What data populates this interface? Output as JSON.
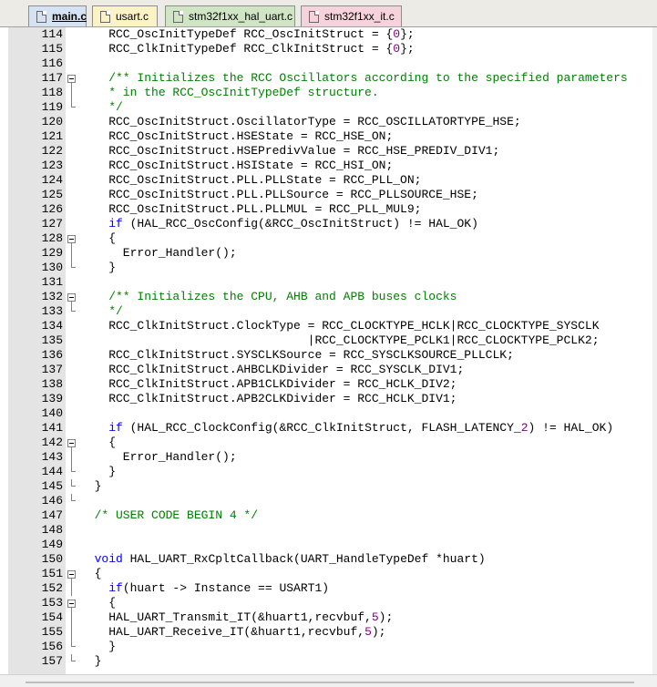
{
  "tabs": [
    {
      "label": "main.c",
      "bg": "#d5e2f3",
      "active": true
    },
    {
      "label": "usart.c",
      "bg": "#fbf3c3",
      "active": false
    },
    {
      "label": "stm32f1xx_hal_uart.c",
      "bg": "#cfe5c4",
      "active": false
    },
    {
      "label": "stm32f1xx_it.c",
      "bg": "#f6d3dc",
      "active": false
    }
  ],
  "colors": {
    "keyword": "#0000ff",
    "comment": "#008000",
    "number": "#800080",
    "gutter": "#e4e4e4"
  },
  "lines": [
    {
      "n": "114",
      "code": [
        [
          "    RCC_OscInitTypeDef RCC_OscInitStruct = {",
          ""
        ],
        [
          "0",
          "num"
        ],
        [
          "};",
          ""
        ]
      ]
    },
    {
      "n": "115",
      "code": [
        [
          "    RCC_ClkInitTypeDef RCC_ClkInitStruct = {",
          ""
        ],
        [
          "0",
          "num"
        ],
        [
          "};",
          ""
        ]
      ]
    },
    {
      "n": "116",
      "code": []
    },
    {
      "n": "117",
      "fold": "box",
      "code": [
        [
          "    /** Initializes the RCC Oscillators according to the specified parameters",
          "cm"
        ]
      ]
    },
    {
      "n": "118",
      "fold": "line",
      "code": [
        [
          "    * in the RCC_OscInitTypeDef structure.",
          "cm"
        ]
      ]
    },
    {
      "n": "119",
      "fold": "end",
      "code": [
        [
          "    */",
          "cm"
        ]
      ]
    },
    {
      "n": "120",
      "code": [
        [
          "    RCC_OscInitStruct.OscillatorType = RCC_OSCILLATORTYPE_HSE;",
          ""
        ]
      ]
    },
    {
      "n": "121",
      "code": [
        [
          "    RCC_OscInitStruct.HSEState = RCC_HSE_ON;",
          ""
        ]
      ]
    },
    {
      "n": "122",
      "code": [
        [
          "    RCC_OscInitStruct.HSEPredivValue = RCC_HSE_PREDIV_DIV1;",
          ""
        ]
      ]
    },
    {
      "n": "123",
      "code": [
        [
          "    RCC_OscInitStruct.HSIState = RCC_HSI_ON;",
          ""
        ]
      ]
    },
    {
      "n": "124",
      "code": [
        [
          "    RCC_OscInitStruct.PLL.PLLState = RCC_PLL_ON;",
          ""
        ]
      ]
    },
    {
      "n": "125",
      "code": [
        [
          "    RCC_OscInitStruct.PLL.PLLSource = RCC_PLLSOURCE_HSE;",
          ""
        ]
      ]
    },
    {
      "n": "126",
      "code": [
        [
          "    RCC_OscInitStruct.PLL.PLLMUL = RCC_PLL_MUL9;",
          ""
        ]
      ]
    },
    {
      "n": "127",
      "code": [
        [
          "    ",
          ""
        ],
        [
          "if",
          "kw"
        ],
        [
          " (HAL_RCC_OscConfig(&RCC_OscInitStruct) != HAL_OK)",
          ""
        ]
      ]
    },
    {
      "n": "128",
      "fold": "box",
      "code": [
        [
          "    {",
          ""
        ]
      ]
    },
    {
      "n": "129",
      "fold": "line",
      "code": [
        [
          "      Error_Handler();",
          ""
        ]
      ]
    },
    {
      "n": "130",
      "fold": "end",
      "code": [
        [
          "    }",
          ""
        ]
      ]
    },
    {
      "n": "131",
      "code": []
    },
    {
      "n": "132",
      "fold": "box",
      "code": [
        [
          "    /** Initializes the CPU, AHB and APB buses clocks",
          "cm"
        ]
      ]
    },
    {
      "n": "133",
      "fold": "end",
      "code": [
        [
          "    */",
          "cm"
        ]
      ]
    },
    {
      "n": "134",
      "code": [
        [
          "    RCC_ClkInitStruct.ClockType = RCC_CLOCKTYPE_HCLK|RCC_CLOCKTYPE_SYSCLK",
          ""
        ]
      ]
    },
    {
      "n": "135",
      "code": [
        [
          "                                |RCC_CLOCKTYPE_PCLK1|RCC_CLOCKTYPE_PCLK2;",
          ""
        ]
      ]
    },
    {
      "n": "136",
      "code": [
        [
          "    RCC_ClkInitStruct.SYSCLKSource = RCC_SYSCLKSOURCE_PLLCLK;",
          ""
        ]
      ]
    },
    {
      "n": "137",
      "code": [
        [
          "    RCC_ClkInitStruct.AHBCLKDivider = RCC_SYSCLK_DIV1;",
          ""
        ]
      ]
    },
    {
      "n": "138",
      "code": [
        [
          "    RCC_ClkInitStruct.APB1CLKDivider = RCC_HCLK_DIV2;",
          ""
        ]
      ]
    },
    {
      "n": "139",
      "code": [
        [
          "    RCC_ClkInitStruct.APB2CLKDivider = RCC_HCLK_DIV1;",
          ""
        ]
      ]
    },
    {
      "n": "140",
      "code": []
    },
    {
      "n": "141",
      "code": [
        [
          "    ",
          ""
        ],
        [
          "if",
          "kw"
        ],
        [
          " (HAL_RCC_ClockConfig(&RCC_ClkInitStruct, FLASH_LATENCY_",
          ""
        ],
        [
          "2",
          "num"
        ],
        [
          ") != HAL_OK)",
          ""
        ]
      ]
    },
    {
      "n": "142",
      "fold": "box",
      "code": [
        [
          "    {",
          ""
        ]
      ]
    },
    {
      "n": "143",
      "fold": "line",
      "code": [
        [
          "      Error_Handler();",
          ""
        ]
      ]
    },
    {
      "n": "144",
      "fold": "end",
      "code": [
        [
          "    }",
          ""
        ]
      ]
    },
    {
      "n": "145",
      "fold": "end",
      "code": [
        [
          "  }",
          ""
        ]
      ]
    },
    {
      "n": "146",
      "fold": "end",
      "code": []
    },
    {
      "n": "147",
      "code": [
        [
          "  /* USER CODE BEGIN 4 */",
          "cm"
        ]
      ]
    },
    {
      "n": "148",
      "code": []
    },
    {
      "n": "149",
      "code": []
    },
    {
      "n": "150",
      "code": [
        [
          "  ",
          ""
        ],
        [
          "void",
          "kw"
        ],
        [
          " HAL_UART_RxCpltCallback(UART_HandleTypeDef *huart)",
          ""
        ]
      ]
    },
    {
      "n": "151",
      "fold": "box",
      "code": [
        [
          "  {",
          ""
        ]
      ]
    },
    {
      "n": "152",
      "fold": "line",
      "code": [
        [
          "    ",
          ""
        ],
        [
          "if",
          "kw"
        ],
        [
          "(huart -> Instance == USART1)",
          ""
        ]
      ]
    },
    {
      "n": "153",
      "fold": "box",
      "code": [
        [
          "    {",
          ""
        ]
      ]
    },
    {
      "n": "154",
      "fold": "line",
      "code": [
        [
          "    HAL_UART_Transmit_IT(&huart1,recvbuf,",
          ""
        ],
        [
          "5",
          "num"
        ],
        [
          ");",
          ""
        ]
      ]
    },
    {
      "n": "155",
      "fold": "line",
      "code": [
        [
          "    HAL_UART_Receive_IT(&huart1,recvbuf,",
          ""
        ],
        [
          "5",
          "num"
        ],
        [
          ");",
          ""
        ]
      ]
    },
    {
      "n": "156",
      "fold": "end",
      "code": [
        [
          "    }",
          ""
        ]
      ]
    },
    {
      "n": "157",
      "fold": "end",
      "code": [
        [
          "  }",
          ""
        ]
      ]
    }
  ]
}
